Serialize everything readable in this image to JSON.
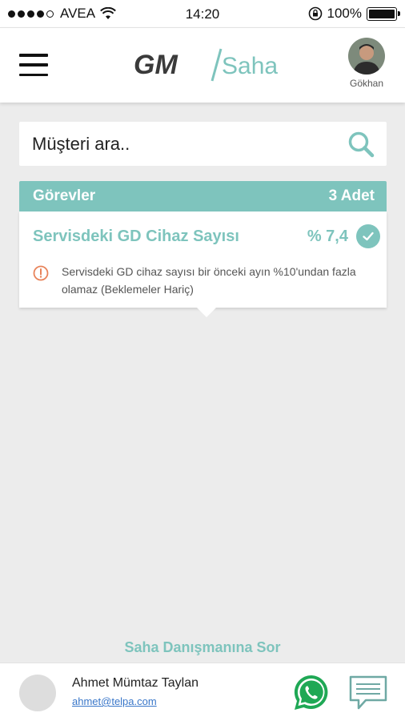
{
  "status_bar": {
    "carrier": "AVEA",
    "time": "14:20",
    "battery": "100%",
    "battery_level": 1.0,
    "signal_bars_filled": 4,
    "signal_bars_total": 5
  },
  "header": {
    "logo_left": "GM",
    "logo_right": "Saha",
    "user_name": "Gökhan"
  },
  "search": {
    "placeholder": "Müşteri ara.."
  },
  "tasks": {
    "title": "Görevler",
    "count": "3 Adet",
    "items": [
      {
        "title": "Servisdeki GD Cihaz Sayısı",
        "value": "% 7,4",
        "note": "Servisdeki GD cihaz sayısı bir önceki ayın %10'undan fazla olamaz (Beklemeler Hariç)"
      }
    ]
  },
  "ask_link": "Saha Danışmanına  Sor",
  "footer": {
    "name": "Ahmet Mümtaz Taylan",
    "email": "ahmet@telpa.com"
  },
  "colors": {
    "accent": "#7ec4bd",
    "logo_dark": "#3a3a3a",
    "warning": "#e8835a",
    "whatsapp": "#1fa855",
    "message": "#6fa9a4"
  },
  "icons": [
    "signal-icon",
    "wifi-icon",
    "rotation-lock-icon",
    "battery-icon",
    "hamburger-menu-icon",
    "avatar",
    "search-icon",
    "check-icon",
    "info-icon",
    "whatsapp-icon",
    "message-icon"
  ]
}
